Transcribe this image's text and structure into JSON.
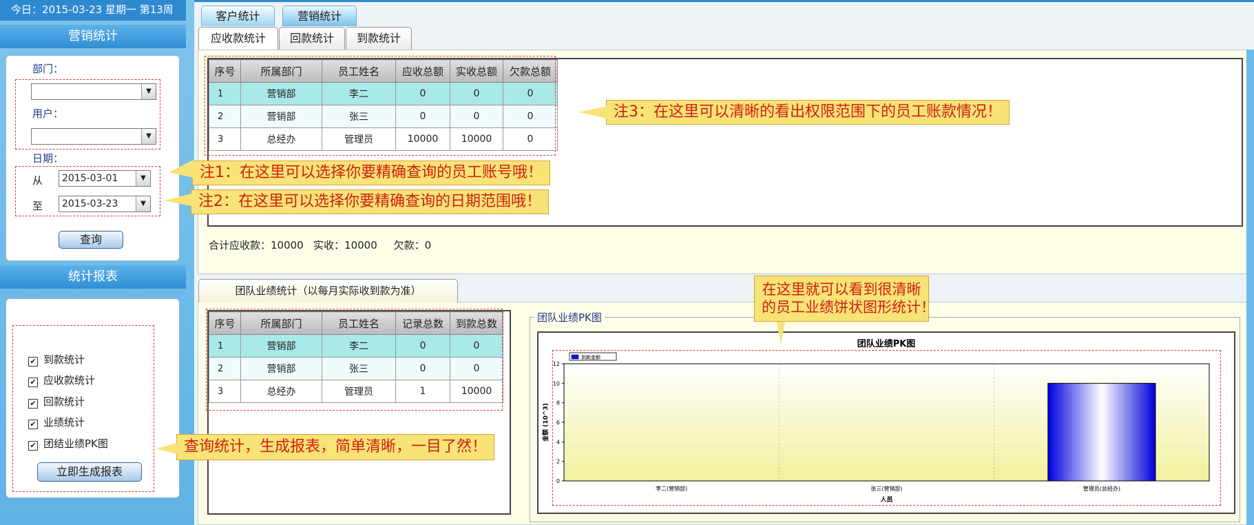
{
  "header": {
    "today": "今日：2015-03-23 星期一 第13周"
  },
  "sidebar": {
    "section1": {
      "title": "营销统计",
      "dept_label": "部门：",
      "user_label": "用户：",
      "date_label": "日期：",
      "from_label": "从",
      "to_label": "至",
      "from_value": "2015-03-01",
      "to_value": "2015-03-23",
      "query_button": "查询"
    },
    "section2": {
      "title": "统计报表",
      "items": [
        {
          "label": "到款统计",
          "checked": true
        },
        {
          "label": "应收款统计",
          "checked": true
        },
        {
          "label": "回款统计",
          "checked": true
        },
        {
          "label": "业绩统计",
          "checked": true
        },
        {
          "label": "团结业绩PK图",
          "checked": true
        }
      ],
      "generate_button": "立即生成报表"
    }
  },
  "top_tabs": [
    "客户统计",
    "营销统计"
  ],
  "sub_tabs": [
    "应收款统计",
    "回款统计",
    "到款统计"
  ],
  "receivable_table": {
    "headers": [
      "序号",
      "所属部门",
      "员工姓名",
      "应收总额",
      "实收总额",
      "欠款总额"
    ],
    "rows": [
      [
        "1",
        "营销部",
        "李二",
        "0",
        "0",
        "0"
      ],
      [
        "2",
        "营销部",
        "张三",
        "0",
        "0",
        "0"
      ],
      [
        "3",
        "总经办",
        "管理员",
        "10000",
        "10000",
        "0"
      ]
    ]
  },
  "summary": {
    "total": "合计应收款：10000",
    "received": "实收：10000",
    "owed": "欠款：0"
  },
  "team_tab": "团队业绩统计（以每月实际收到款为准）",
  "team_table": {
    "headers": [
      "序号",
      "所属部门",
      "员工姓名",
      "记录总数",
      "到款总数"
    ],
    "rows": [
      [
        "1",
        "营销部",
        "李二",
        "0",
        "0"
      ],
      [
        "2",
        "营销部",
        "张三",
        "0",
        "0"
      ],
      [
        "3",
        "总经办",
        "管理员",
        "1",
        "10000"
      ]
    ]
  },
  "pk_fieldset": "团队业绩PK图",
  "chart_data": {
    "type": "bar",
    "title": "团队业绩PK图",
    "legend": "到款金额",
    "xlabel": "人员",
    "ylabel": "金额 (10^3)",
    "categories": [
      "李二(营销部)",
      "张三(营销部)",
      "管理员(总经办)"
    ],
    "values": [
      0,
      0,
      10
    ],
    "ylim": [
      0,
      12
    ],
    "yticks": [
      "0",
      "2",
      "4",
      "6",
      "8",
      "10",
      "12"
    ],
    "grid": false
  },
  "notes": {
    "n1": "注1：在这里可以选择你要精确查询的员工账号哦！",
    "n2": "注2：在这里可以选择你要精确查询的日期范围哦！",
    "n3": "注3：在这里可以清晰的看出权限范围下的员工账款情况！",
    "n4_line1": "在这里就可以看到很清晰",
    "n4_line2": "的员工业绩饼状图形统计！",
    "n5": "查询统计，生成报表，简单清晰，一目了然！"
  },
  "colors": {
    "sidebar": "#6cbbea",
    "header_blue": "#2f8fd5",
    "note_bg": "#f8e377",
    "note_text": "#d02010",
    "row_cyan": "#a9e9e8",
    "chart_bg": "#f7f7c2",
    "bar": "#1010e8"
  }
}
